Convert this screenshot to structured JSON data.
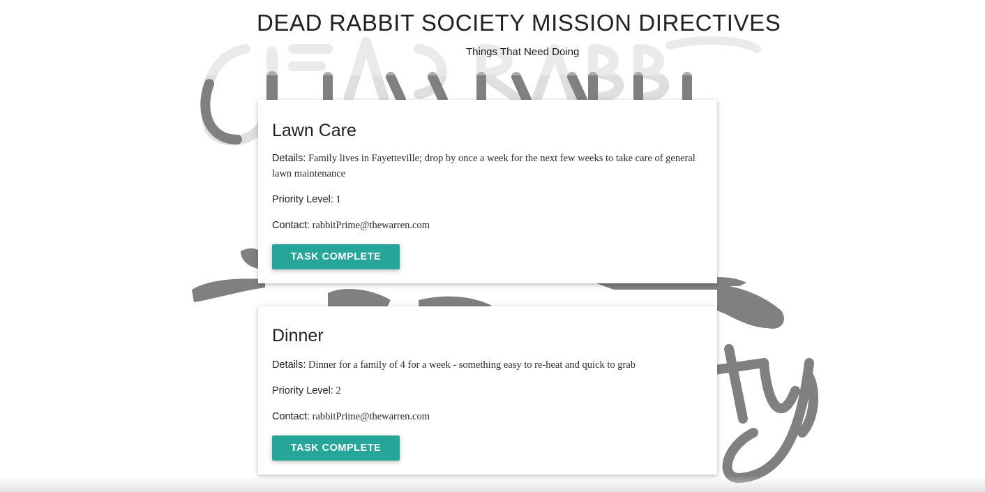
{
  "header": {
    "title": "DEAD RABBIT SOCIETY MISSION DIRECTIVES",
    "subtitle": "Things That Need Doing"
  },
  "background": {
    "logo_icon": "dead-rabbit-society-logo",
    "logo_color": "#808080"
  },
  "tasks": [
    {
      "title": "Lawn Care",
      "details_label": "Details:",
      "details": "Family lives in Fayetteville; drop by once a week for the next few weeks to take care of general lawn maintenance",
      "priority_label": "Priority Level:",
      "priority": "1",
      "contact_label": "Contact:",
      "contact": "rabbitPrime@thewarren.com",
      "button_label": "Task Complete"
    },
    {
      "title": "Dinner",
      "details_label": "Details:",
      "details": "Dinner for a family of 4 for a week - something easy to re-heat and quick to grab",
      "priority_label": "Priority Level:",
      "priority": "2",
      "contact_label": "Contact:",
      "contact": "rabbitPrime@thewarren.com",
      "button_label": "Task Complete"
    }
  ],
  "colors": {
    "accent": "#26a69a",
    "text": "#212121"
  }
}
